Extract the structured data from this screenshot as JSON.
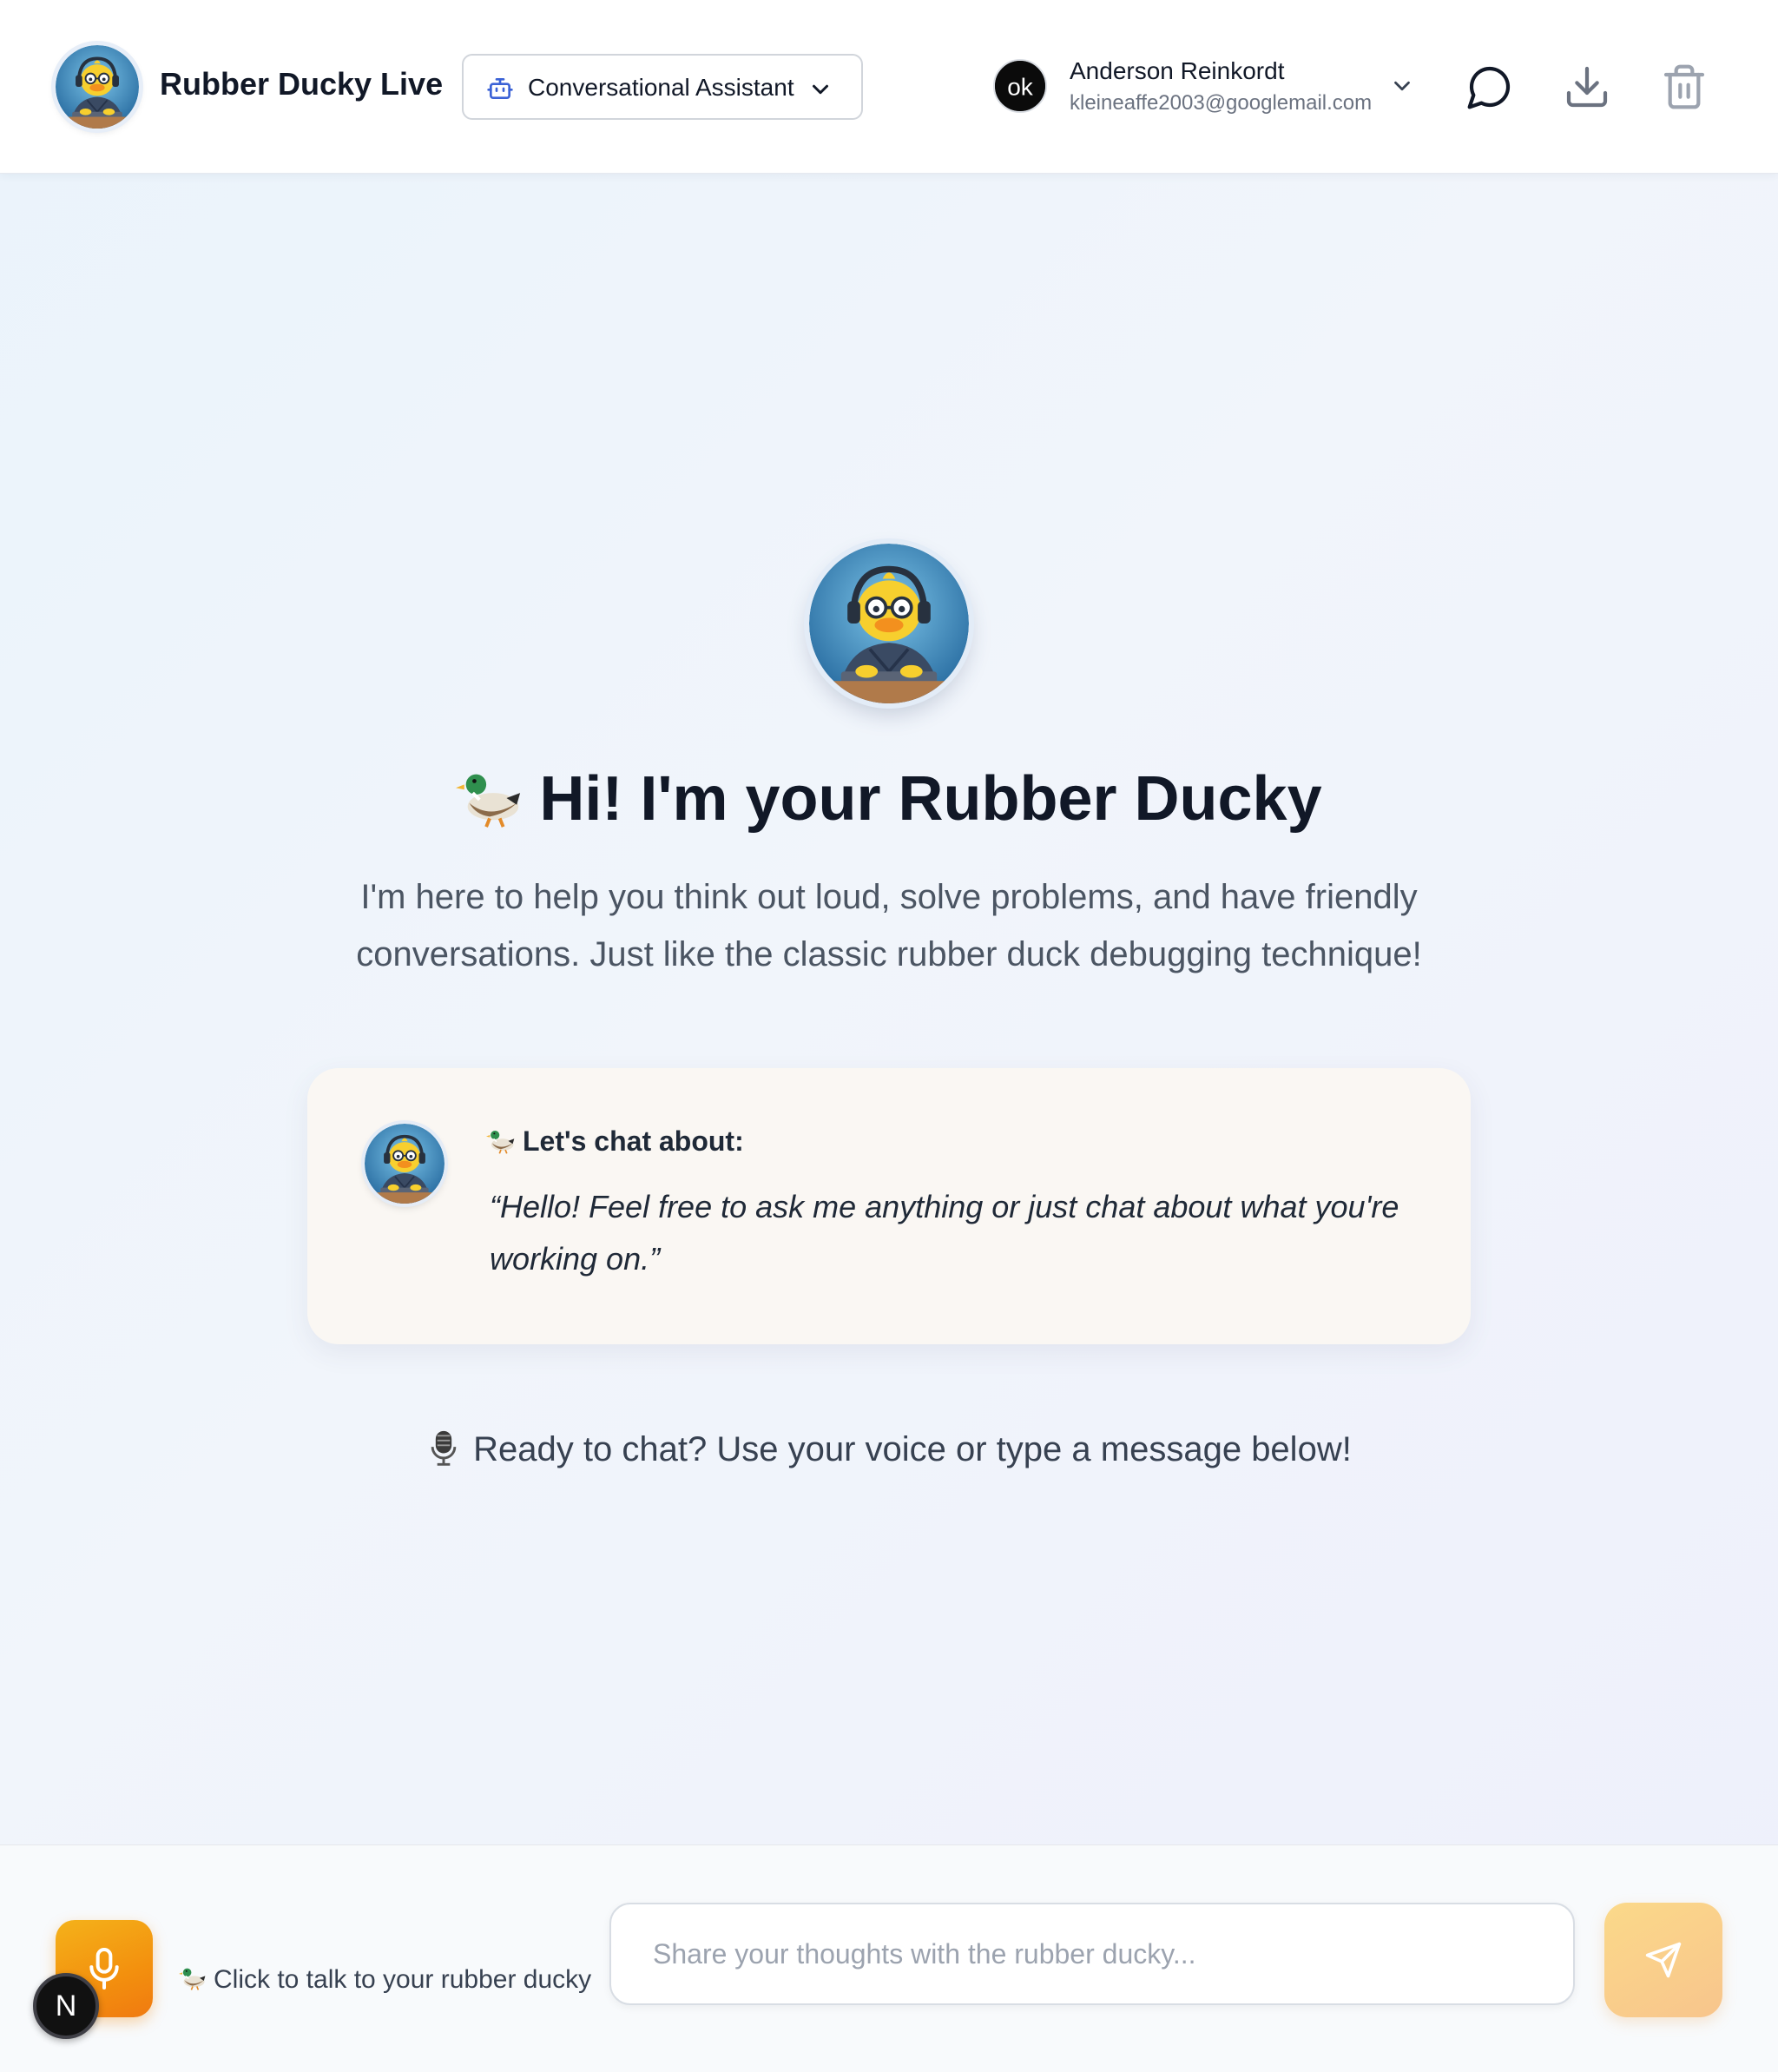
{
  "header": {
    "brand_title": "Rubber Ducky Live",
    "mode_selector": {
      "label": "Conversational Assistant"
    },
    "user": {
      "name": "Anderson Reinkordt",
      "email": "kleineaffe2003@googlemail.com",
      "avatar_text": "ok"
    },
    "icons": [
      "chat-bubble-icon",
      "download-icon",
      "trash-icon"
    ]
  },
  "hero": {
    "title": "Hi! I'm your Rubber Ducky",
    "subtitle": "I'm here to help you think out loud, solve problems, and have friendly conversations. Just like the classic rubber duck debugging technique!"
  },
  "suggestion_card": {
    "heading": "Let's chat about:",
    "quote": "“Hello! Feel free to ask me anything or just chat about what you're working on.”"
  },
  "ready_prompt": "Ready to chat? Use your voice or type a message below!",
  "footer": {
    "talk_label": "Click to talk to your rubber ducky",
    "input_placeholder": "Share your thoughts with the rubber ducky...",
    "input_value": "",
    "badge_letter": "N"
  },
  "colors": {
    "accent_orange": "#f3900e",
    "send_button": "#f8c58c",
    "text_primary": "#111827",
    "text_secondary": "#4b5563"
  }
}
